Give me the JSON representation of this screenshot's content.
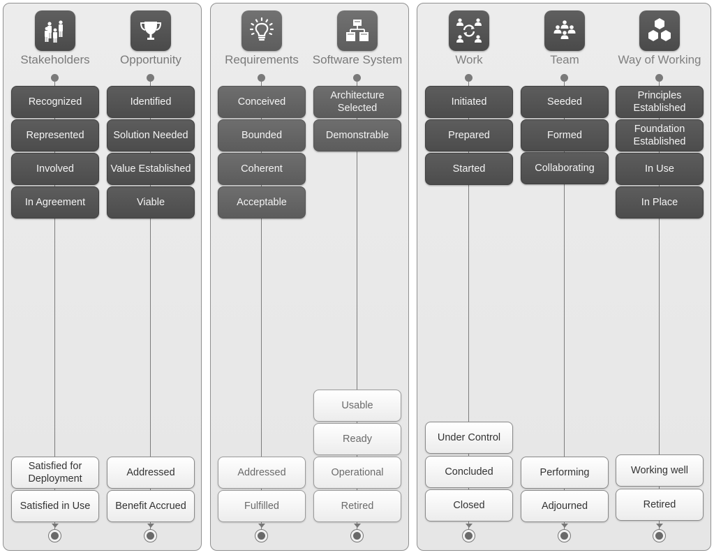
{
  "panels": [
    {
      "alphas": [
        {
          "name": "Stakeholders",
          "icon": "stakeholders-group-icon",
          "top_states": [
            "Recognized",
            "Represented",
            "Involved",
            "In Agreement"
          ],
          "bottom_states": [
            "Satisfied for Deployment",
            "Satisfied in Use"
          ]
        },
        {
          "name": "Opportunity",
          "icon": "trophy-icon",
          "top_states": [
            "Identified",
            "Solution Needed",
            "Value Established",
            "Viable"
          ],
          "bottom_states": [
            "Addressed",
            "Benefit Accrued"
          ]
        }
      ]
    },
    {
      "alphas": [
        {
          "name": "Requirements",
          "icon": "lightbulb-icon",
          "top_states": [
            "Conceived",
            "Bounded",
            "Coherent",
            "Acceptable"
          ],
          "bottom_states": [
            "Addressed",
            "Fulfilled"
          ]
        },
        {
          "name": "Software System",
          "icon": "hierarchy-icon",
          "top_states": [
            "Architecture Selected",
            "Demonstrable"
          ],
          "bottom_states": [
            "Usable",
            "Ready",
            "Operational",
            "Retired"
          ]
        }
      ]
    },
    {
      "alphas": [
        {
          "name": "Work",
          "icon": "work-cycle-icon",
          "top_states": [
            "Initiated",
            "Prepared",
            "Started"
          ],
          "bottom_states": [
            "Under Control",
            "Concluded",
            "Closed"
          ]
        },
        {
          "name": "Team",
          "icon": "team-icon",
          "top_states": [
            "Seeded",
            "Formed",
            "Collaborating"
          ],
          "bottom_states": [
            "Performing",
            "Adjourned"
          ]
        },
        {
          "name": "Way of Working",
          "icon": "hexagons-icon",
          "top_states": [
            "Principles Established",
            "Foundation Established",
            "In Use",
            "In Place"
          ],
          "bottom_states": [
            "Working well",
            "Retired"
          ]
        }
      ]
    }
  ],
  "colors": {
    "achieved_state": "#555555",
    "pending_state": "#f5f5f5",
    "panel_background": "#e8e8e8",
    "label_text": "#7a7a7a"
  }
}
